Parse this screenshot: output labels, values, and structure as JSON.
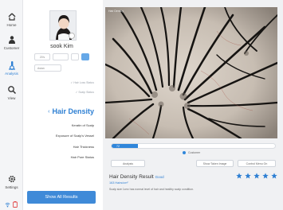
{
  "sidebar": {
    "items": [
      {
        "label": "Home",
        "icon": "home-icon"
      },
      {
        "label": "Customer",
        "icon": "customer-icon"
      },
      {
        "label": "Analysis",
        "icon": "analysis-icon"
      },
      {
        "label": "View",
        "icon": "search-icon"
      },
      {
        "label": "Settings",
        "icon": "gear-icon"
      }
    ],
    "bottom_icons": [
      "wifi-icon",
      "battery-icon"
    ]
  },
  "profile": {
    "name": "sook Kim",
    "controls": [
      "20's",
      "",
      "",
      ""
    ],
    "select_value": "Asian"
  },
  "menu": {
    "checked": [
      "Hair Loss Status",
      "Scalp Status"
    ],
    "active": "Hair Density",
    "items": [
      "Keratin of Scalp",
      "Exposure of Scalp's Vessel",
      "Hair Thickness",
      "Hair Pore Status"
    ]
  },
  "show_all_button": "Show All Results",
  "image": {
    "label": "Hair Density"
  },
  "progress": {
    "value_label": "72",
    "fraction": 0.16,
    "legend": "Customer"
  },
  "actions": {
    "left": "Analysis",
    "middle": "Show Taken Image",
    "right": "Control Menu On"
  },
  "result": {
    "title": "Hair Density Result",
    "grade": "Good",
    "subtitle": "163 Hairs/cm²",
    "description": "Scalp size 1cm² has normal level of hair and healthy scalp condition.",
    "stars": 5
  },
  "colors": {
    "accent": "#2d7fd3",
    "button": "#3f8ad8"
  }
}
